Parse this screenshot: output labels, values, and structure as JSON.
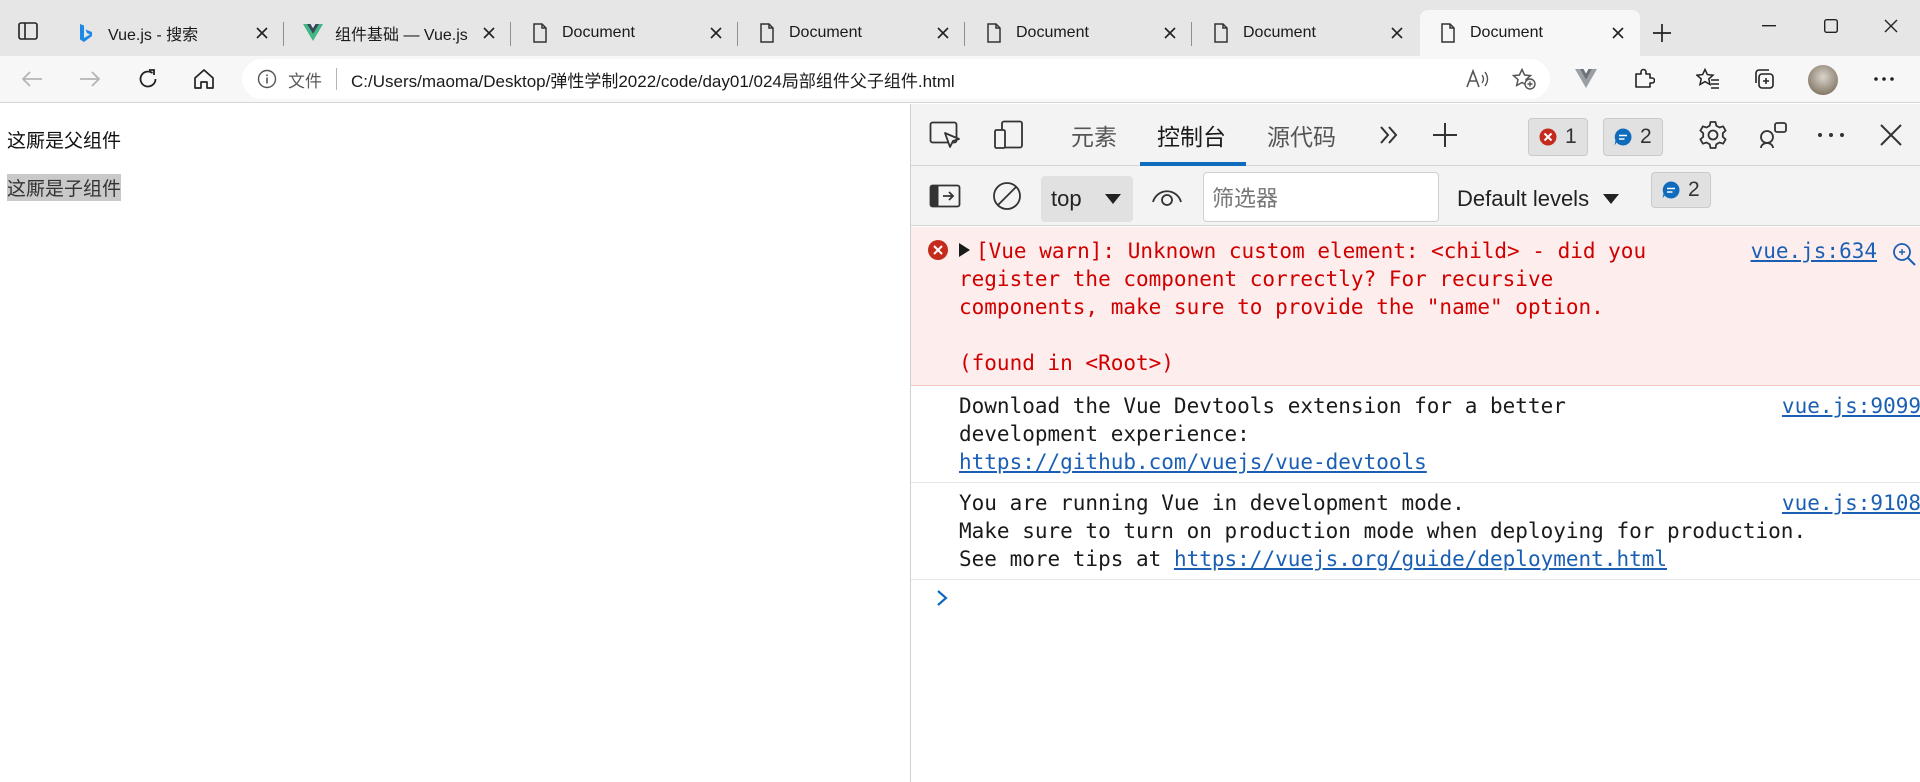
{
  "browser": {
    "tabs": [
      {
        "title": "Vue.js - 搜索",
        "favicon": "bing-icon"
      },
      {
        "title": "组件基础 — Vue.js",
        "favicon": "vue-icon"
      },
      {
        "title": "Document",
        "favicon": "document-icon"
      },
      {
        "title": "Document",
        "favicon": "document-icon"
      },
      {
        "title": "Document",
        "favicon": "document-icon"
      },
      {
        "title": "Document",
        "favicon": "document-icon"
      },
      {
        "title": "Document",
        "favicon": "document-icon",
        "active": true
      }
    ],
    "address": {
      "scheme_label": "文件",
      "url": "C:/Users/maoma/Desktop/弹性学制2022/code/day01/024局部组件父子组件.html"
    }
  },
  "page": {
    "parent_text": "这厮是父组件",
    "child_text": "这厮是子组件"
  },
  "devtools": {
    "tabs": {
      "elements": "元素",
      "console": "控制台",
      "sources": "源代码"
    },
    "error_count": "1",
    "message_count": "2",
    "context": "top",
    "filter_placeholder": "筛选器",
    "levels": "Default levels",
    "issues_count": "2",
    "messages": [
      {
        "level": "error",
        "text": "[Vue warn]: Unknown custom element: <child> - did you register the component correctly? For recursive components, make sure to provide the \"name\" option.",
        "found_in": "(found in <Root>)",
        "source": "vue.js:634"
      },
      {
        "level": "info",
        "text": "Download the Vue Devtools extension for a better development experience:",
        "link": "https://github.com/vuejs/vue-devtools",
        "source": "vue.js:9099"
      },
      {
        "level": "info",
        "text_line1": "You are running Vue in development mode.",
        "text_line2": "Make sure to turn on production mode when deploying for production.",
        "text_line3_prefix": "See more tips at ",
        "link": "https://vuejs.org/guide/deployment.html",
        "source": "vue.js:9108"
      }
    ]
  },
  "colors": {
    "accent": "#0f6cbd",
    "error_text": "#d10000",
    "error_bg": "#fdeded",
    "link": "#1a5fb4"
  }
}
